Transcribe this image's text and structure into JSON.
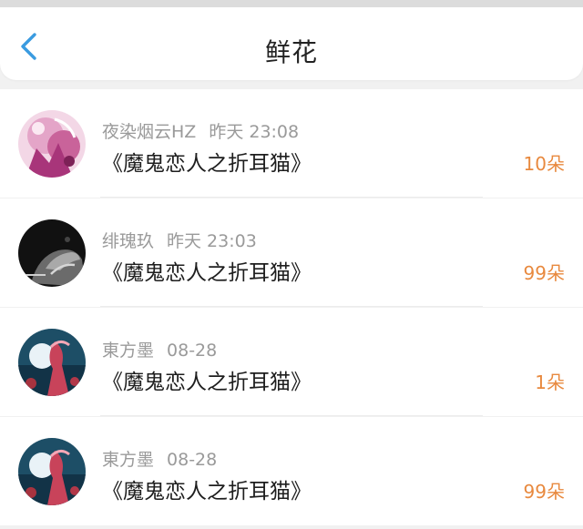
{
  "header": {
    "title": "鲜花",
    "back_icon": "chevron-left-icon",
    "accent_color": "#3a9be0"
  },
  "rows": [
    {
      "user": "夜染烟云HZ",
      "time": "昨天 23:08",
      "book": "《魔鬼恋人之折耳猫》",
      "count": "10朵",
      "avatar": "pink-anime-avatar"
    },
    {
      "user": "绯瑰玖",
      "time": "昨天 23:03",
      "book": "《魔鬼恋人之折耳猫》",
      "count": "99朵",
      "avatar": "dark-hands-avatar"
    },
    {
      "user": "東方墨",
      "time": "08-28",
      "book": "《魔鬼恋人之折耳猫》",
      "count": "1朵",
      "avatar": "moon-anime-avatar"
    },
    {
      "user": "東方墨",
      "time": "08-28",
      "book": "《魔鬼恋人之折耳猫》",
      "count": "99朵",
      "avatar": "moon-anime-avatar"
    }
  ],
  "count_color": "#e8893e"
}
